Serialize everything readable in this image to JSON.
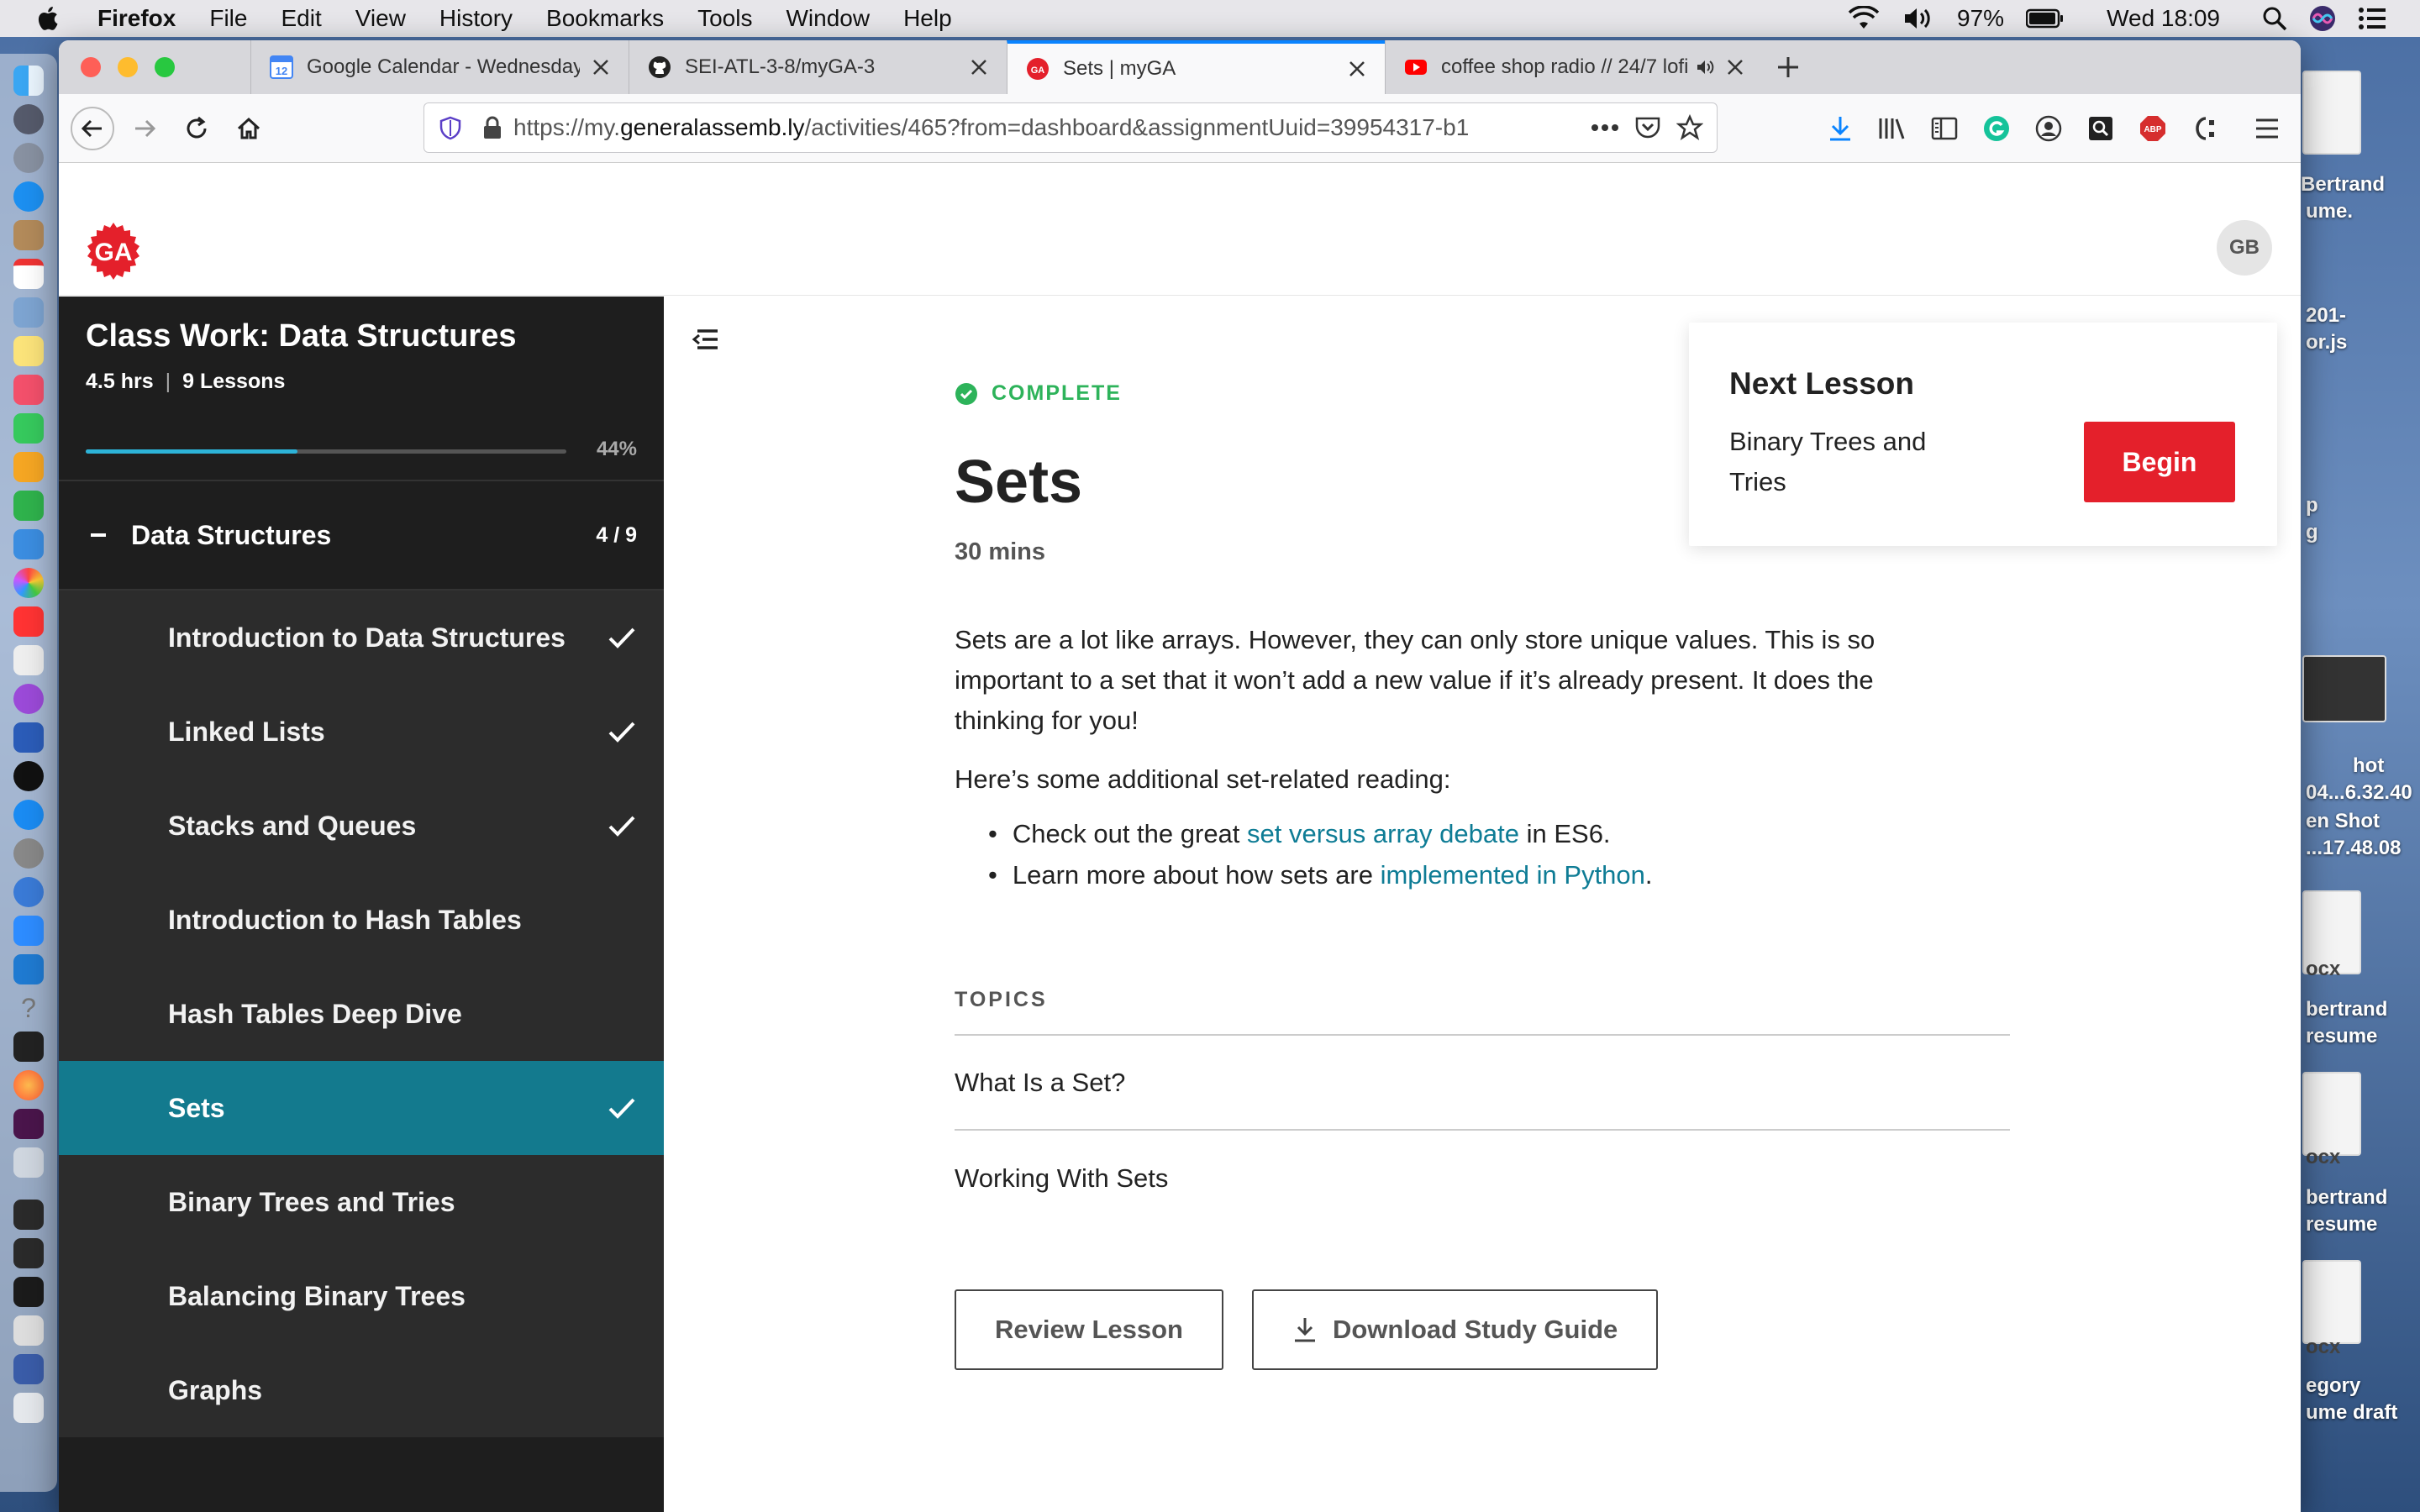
{
  "menubar": {
    "app": "Firefox",
    "menus": [
      "File",
      "Edit",
      "View",
      "History",
      "Bookmarks",
      "Tools",
      "Window",
      "Help"
    ],
    "battery": "97%",
    "clock": "Wed 18:09"
  },
  "browser": {
    "tabs": [
      {
        "title": "Google Calendar - Wednesday,",
        "favicon": "calendar-icon",
        "favicon_text": "12"
      },
      {
        "title": "SEI-ATL-3-8/myGA-3",
        "favicon": "github-icon"
      },
      {
        "title": "Sets | myGA",
        "favicon": "ga-icon",
        "active": true
      },
      {
        "title": "coffee shop radio // 24/7 lofi",
        "favicon": "youtube-icon",
        "audio": true
      }
    ],
    "url_prefix": "https://my.",
    "url_domain": "generalassemb.ly",
    "url_rest": "/activities/465?from=dashboard&assignmentUuid=39954317-b1",
    "ext_badges": {
      "abp": "ABP"
    }
  },
  "site": {
    "logo_text": "GA",
    "avatar_initials": "GB"
  },
  "sidebar": {
    "title": "Class Work: Data Structures",
    "hours": "4.5 hrs",
    "sep": "|",
    "lessons_count": "9 Lessons",
    "progress": 0.44,
    "progress_label": "44%",
    "section": {
      "title": "Data Structures",
      "count": "4 / 9"
    },
    "lessons": [
      {
        "label": "Introduction to Data Structures",
        "done": true
      },
      {
        "label": "Linked Lists",
        "done": true
      },
      {
        "label": "Stacks and Queues",
        "done": true
      },
      {
        "label": "Introduction to Hash Tables",
        "done": false
      },
      {
        "label": "Hash Tables Deep Dive",
        "done": false
      },
      {
        "label": "Sets",
        "done": true,
        "active": true
      },
      {
        "label": "Binary Trees and Tries",
        "done": false
      },
      {
        "label": "Balancing Binary Trees",
        "done": false
      },
      {
        "label": "Graphs",
        "done": false
      }
    ]
  },
  "lesson": {
    "status": "COMPLETE",
    "title": "Sets",
    "duration": "30 mins",
    "body": "Sets are a lot like arrays. However, they can only store unique values. This is so important to a set that it won’t add a new value if it’s already present. It does the thinking for you!",
    "reading_intro": "Here’s some additional set-related reading:",
    "links": [
      {
        "before": "Check out the great ",
        "link": "set versus array debate",
        "after": " in ES6."
      },
      {
        "before": "Learn more about how sets are ",
        "link": "implemented in Python",
        "after": "."
      }
    ],
    "topics_label": "TOPICS",
    "topics": [
      "What Is a Set?",
      "Working With Sets"
    ],
    "review_label": "Review Lesson",
    "download_label": "Download Study Guide"
  },
  "next_lesson": {
    "heading": "Next Lesson",
    "name": "Binary Trees and Tries",
    "begin_label": "Begin"
  },
  "desktop": {
    "labels": [
      "Bertrand",
      "ume.",
      "201-",
      "or.js",
      "p",
      "g",
      "hot",
      "04...6.32.40",
      "en Shot",
      "...17.48.08",
      "ocx",
      "bertrand",
      "resume",
      "ocx",
      "bertrand",
      "resume",
      "ocx",
      "egory",
      "ume draft"
    ]
  },
  "colors": {
    "accent": "#137a8e",
    "progress": "#2db3d8",
    "complete": "#2db35a",
    "begin": "#e4202b",
    "link": "#0e7c95"
  }
}
